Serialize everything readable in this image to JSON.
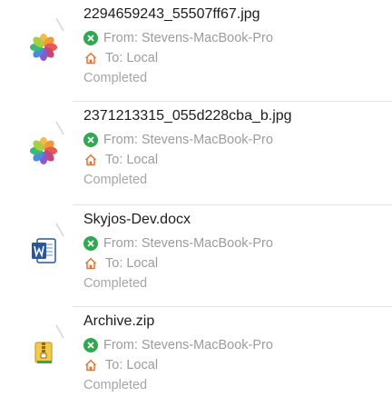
{
  "transfers": [
    {
      "filename": "2294659243_55507ff67.jpg",
      "file_icon": "photos-icon",
      "from": "From: Stevens-MacBook-Pro",
      "to": "To: Local",
      "status": "Completed"
    },
    {
      "filename": "2371213315_055d228cba_b.jpg",
      "file_icon": "photos-icon",
      "from": "From: Stevens-MacBook-Pro",
      "to": "To: Local",
      "status": "Completed"
    },
    {
      "filename": "Skyjos-Dev.docx",
      "file_icon": "word-document-icon",
      "from": "From: Stevens-MacBook-Pro",
      "to": "To: Local",
      "status": "Completed"
    },
    {
      "filename": "Archive.zip",
      "file_icon": "archive-icon",
      "from": "From: Stevens-MacBook-Pro",
      "to": "To: Local",
      "status": "Completed"
    }
  ],
  "colors": {
    "from_icon": "#2fa84f",
    "to_icon": "#e8722b",
    "status_text": "#a5a5aa",
    "separator": "#e3e3e6"
  }
}
